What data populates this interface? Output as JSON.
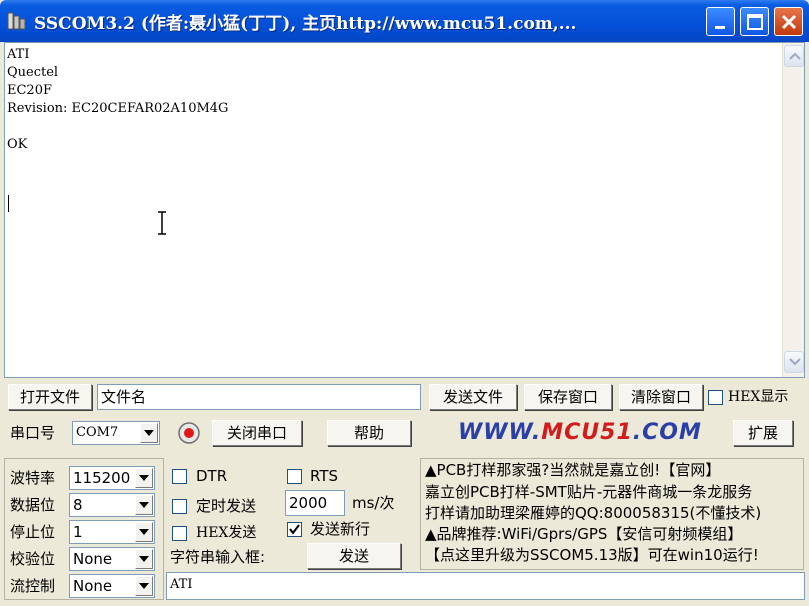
{
  "window": {
    "title": "SSCOM3.2 (作者:聂小猛(丁丁), 主页http://www.mcu51.com,..."
  },
  "receive": {
    "text": "ATI\nQuectel\nEC20F\nRevision: EC20CEFAR02A10M4G\n\nOK"
  },
  "file_row": {
    "open_file": "打开文件",
    "file_name": "文件名",
    "send_file": "发送文件",
    "save_window": "保存窗口",
    "clear_window": "清除窗口",
    "hex_display": "HEX显示",
    "hex_display_checked": false
  },
  "port_row": {
    "port_label": "串口号",
    "port_value": "COM7",
    "close_port": "关闭串口",
    "help": "帮助",
    "expand": "扩展"
  },
  "logo": {
    "part1": "WWW.",
    "part2": "MCU51",
    "part3": ".COM"
  },
  "settings": {
    "baud_label": "波特率",
    "baud_value": "115200",
    "data_label": "数据位",
    "data_value": "8",
    "stop_label": "停止位",
    "stop_value": "1",
    "parity_label": "校验位",
    "parity_value": "None",
    "flow_label": "流控制",
    "flow_value": "None"
  },
  "options": {
    "dtr": "DTR",
    "dtr_checked": false,
    "rts": "RTS",
    "rts_checked": false,
    "timed_send": "定时发送",
    "timed_send_checked": false,
    "interval_value": "2000",
    "interval_unit": "ms/次",
    "hex_send": "HEX发送",
    "hex_send_checked": false,
    "send_newline": "发送新行",
    "send_newline_checked": true,
    "input_label": "字符串输入框:",
    "send_button": "发送"
  },
  "ad": {
    "line1": "▲PCB打样那家强?当然就是嘉立创!【官网】",
    "line2": "嘉立创PCB打样-SMT贴片-元器件商城一条龙服务",
    "line3": "打样请加助理梁雁婷的QQ:800058315(不懂技术)",
    "line4": "▲品牌推荐:WiFi/Gprs/GPS【安信可射频模组】",
    "line5": "【点这里升级为SSCOM5.13版】可在win10运行!"
  },
  "send_input": {
    "value": "ATI"
  }
}
